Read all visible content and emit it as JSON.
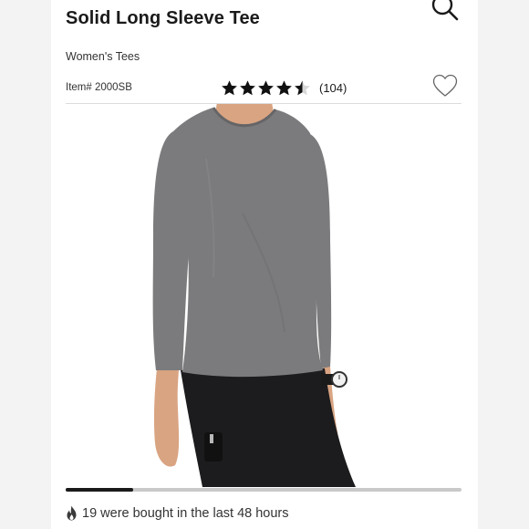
{
  "product": {
    "title": "Solid Long Sleeve Tee",
    "category": "Women's Tees",
    "item_number": "Item# 2000SB"
  },
  "rating": {
    "value": 4.5,
    "max": 5,
    "review_count": "(104)"
  },
  "icons": {
    "search": "search-icon",
    "favorite": "heart-outline-icon",
    "flame": "flame-icon"
  },
  "carousel": {
    "progress": 0.17
  },
  "social_proof": {
    "text": "19 were bought in the last 48 hours"
  },
  "colors": {
    "shirt": "#7b7b7d",
    "pants": "#1c1c1e",
    "skin": "#d9a482"
  }
}
